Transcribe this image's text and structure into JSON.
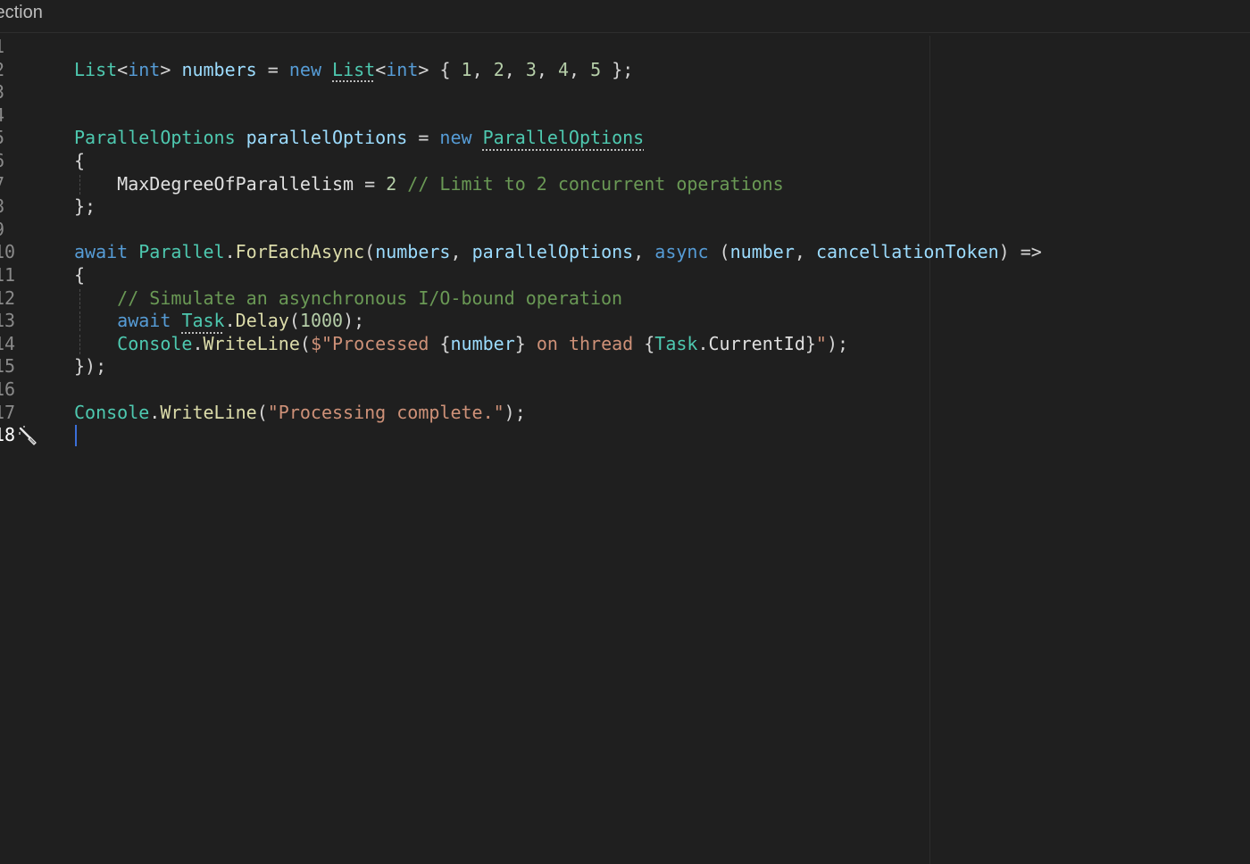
{
  "header": {
    "title": "lection"
  },
  "editor": {
    "active_line": 18,
    "lines": [
      {
        "num": "1",
        "tokens": []
      },
      {
        "num": "2",
        "tokens": [
          {
            "t": "List",
            "c": "type"
          },
          {
            "t": "<",
            "c": "plain"
          },
          {
            "t": "int",
            "c": "kw"
          },
          {
            "t": "> ",
            "c": "plain"
          },
          {
            "t": "numbers",
            "c": "var"
          },
          {
            "t": " = ",
            "c": "plain"
          },
          {
            "t": "new",
            "c": "kw"
          },
          {
            "t": " ",
            "c": "plain"
          },
          {
            "t": "List",
            "c": "type",
            "d": true
          },
          {
            "t": "<",
            "c": "plain"
          },
          {
            "t": "int",
            "c": "kw"
          },
          {
            "t": "> { ",
            "c": "plain"
          },
          {
            "t": "1",
            "c": "num"
          },
          {
            "t": ", ",
            "c": "plain"
          },
          {
            "t": "2",
            "c": "num"
          },
          {
            "t": ", ",
            "c": "plain"
          },
          {
            "t": "3",
            "c": "num"
          },
          {
            "t": ", ",
            "c": "plain"
          },
          {
            "t": "4",
            "c": "num"
          },
          {
            "t": ", ",
            "c": "plain"
          },
          {
            "t": "5",
            "c": "num"
          },
          {
            "t": " };",
            "c": "plain"
          }
        ]
      },
      {
        "num": "3",
        "tokens": []
      },
      {
        "num": "4",
        "tokens": []
      },
      {
        "num": "5",
        "tokens": [
          {
            "t": "ParallelOptions",
            "c": "type"
          },
          {
            "t": " ",
            "c": "plain"
          },
          {
            "t": "parallelOptions",
            "c": "var"
          },
          {
            "t": " = ",
            "c": "plain"
          },
          {
            "t": "new",
            "c": "kw"
          },
          {
            "t": " ",
            "c": "plain"
          },
          {
            "t": "ParallelOptions",
            "c": "type",
            "d": true
          }
        ]
      },
      {
        "num": "6",
        "tokens": [
          {
            "t": "{",
            "c": "plain"
          }
        ]
      },
      {
        "num": "7",
        "guide": true,
        "tokens": [
          {
            "t": "    MaxDegreeOfParallelism",
            "c": "prop"
          },
          {
            "t": " = ",
            "c": "plain"
          },
          {
            "t": "2",
            "c": "num"
          },
          {
            "t": " // Limit to 2 concurrent operations",
            "c": "com"
          }
        ]
      },
      {
        "num": "8",
        "tokens": [
          {
            "t": "};",
            "c": "plain"
          }
        ]
      },
      {
        "num": "9",
        "tokens": []
      },
      {
        "num": "10",
        "tokens": [
          {
            "t": "await",
            "c": "kw"
          },
          {
            "t": " ",
            "c": "plain"
          },
          {
            "t": "Parallel",
            "c": "type"
          },
          {
            "t": ".",
            "c": "plain"
          },
          {
            "t": "ForEachAsync",
            "c": "fn"
          },
          {
            "t": "(",
            "c": "plain"
          },
          {
            "t": "numbers",
            "c": "var"
          },
          {
            "t": ", ",
            "c": "plain"
          },
          {
            "t": "parallelOptions",
            "c": "var"
          },
          {
            "t": ", ",
            "c": "plain"
          },
          {
            "t": "async",
            "c": "kw"
          },
          {
            "t": " (",
            "c": "plain"
          },
          {
            "t": "number",
            "c": "var"
          },
          {
            "t": ", ",
            "c": "plain"
          },
          {
            "t": "cancellationToken",
            "c": "var"
          },
          {
            "t": ") =>",
            "c": "plain"
          }
        ]
      },
      {
        "num": "11",
        "tokens": [
          {
            "t": "{",
            "c": "plain"
          }
        ]
      },
      {
        "num": "12",
        "guide": true,
        "tokens": [
          {
            "t": "    // Simulate an asynchronous I/O-bound operation",
            "c": "com"
          }
        ]
      },
      {
        "num": "13",
        "guide": true,
        "tokens": [
          {
            "t": "    ",
            "c": "plain"
          },
          {
            "t": "await",
            "c": "kw"
          },
          {
            "t": " ",
            "c": "plain"
          },
          {
            "t": "Task",
            "c": "type",
            "d": true
          },
          {
            "t": ".",
            "c": "plain"
          },
          {
            "t": "Delay",
            "c": "fn"
          },
          {
            "t": "(",
            "c": "plain"
          },
          {
            "t": "1000",
            "c": "num"
          },
          {
            "t": ");",
            "c": "plain"
          }
        ]
      },
      {
        "num": "14",
        "guide": true,
        "tokens": [
          {
            "t": "    ",
            "c": "plain"
          },
          {
            "t": "Console",
            "c": "type"
          },
          {
            "t": ".",
            "c": "plain"
          },
          {
            "t": "WriteLine",
            "c": "fn"
          },
          {
            "t": "(",
            "c": "plain"
          },
          {
            "t": "$\"Processed ",
            "c": "str"
          },
          {
            "t": "{",
            "c": "plain"
          },
          {
            "t": "number",
            "c": "var"
          },
          {
            "t": "}",
            "c": "plain"
          },
          {
            "t": " on thread ",
            "c": "str"
          },
          {
            "t": "{",
            "c": "plain"
          },
          {
            "t": "Task",
            "c": "type"
          },
          {
            "t": ".",
            "c": "plain"
          },
          {
            "t": "CurrentId",
            "c": "prop"
          },
          {
            "t": "}",
            "c": "plain"
          },
          {
            "t": "\"",
            "c": "str"
          },
          {
            "t": ");",
            "c": "plain"
          }
        ]
      },
      {
        "num": "15",
        "tokens": [
          {
            "t": "});",
            "c": "plain"
          }
        ]
      },
      {
        "num": "16",
        "tokens": []
      },
      {
        "num": "17",
        "tokens": [
          {
            "t": "Console",
            "c": "type"
          },
          {
            "t": ".",
            "c": "plain"
          },
          {
            "t": "WriteLine",
            "c": "fn"
          },
          {
            "t": "(",
            "c": "plain"
          },
          {
            "t": "\"Processing complete.\"",
            "c": "str"
          },
          {
            "t": ");",
            "c": "plain"
          }
        ]
      },
      {
        "num": "18",
        "tokens": [],
        "cursor": true,
        "gutter_icon": "magic-wand-icon"
      }
    ]
  },
  "colors": {
    "background": "#1f1f1f",
    "type": "#4ec9b0",
    "keyword": "#569cd6",
    "variable": "#9cdcfe",
    "number": "#b5cea8",
    "string": "#ce9178",
    "comment": "#6a9955",
    "function": "#dcdcaa"
  }
}
